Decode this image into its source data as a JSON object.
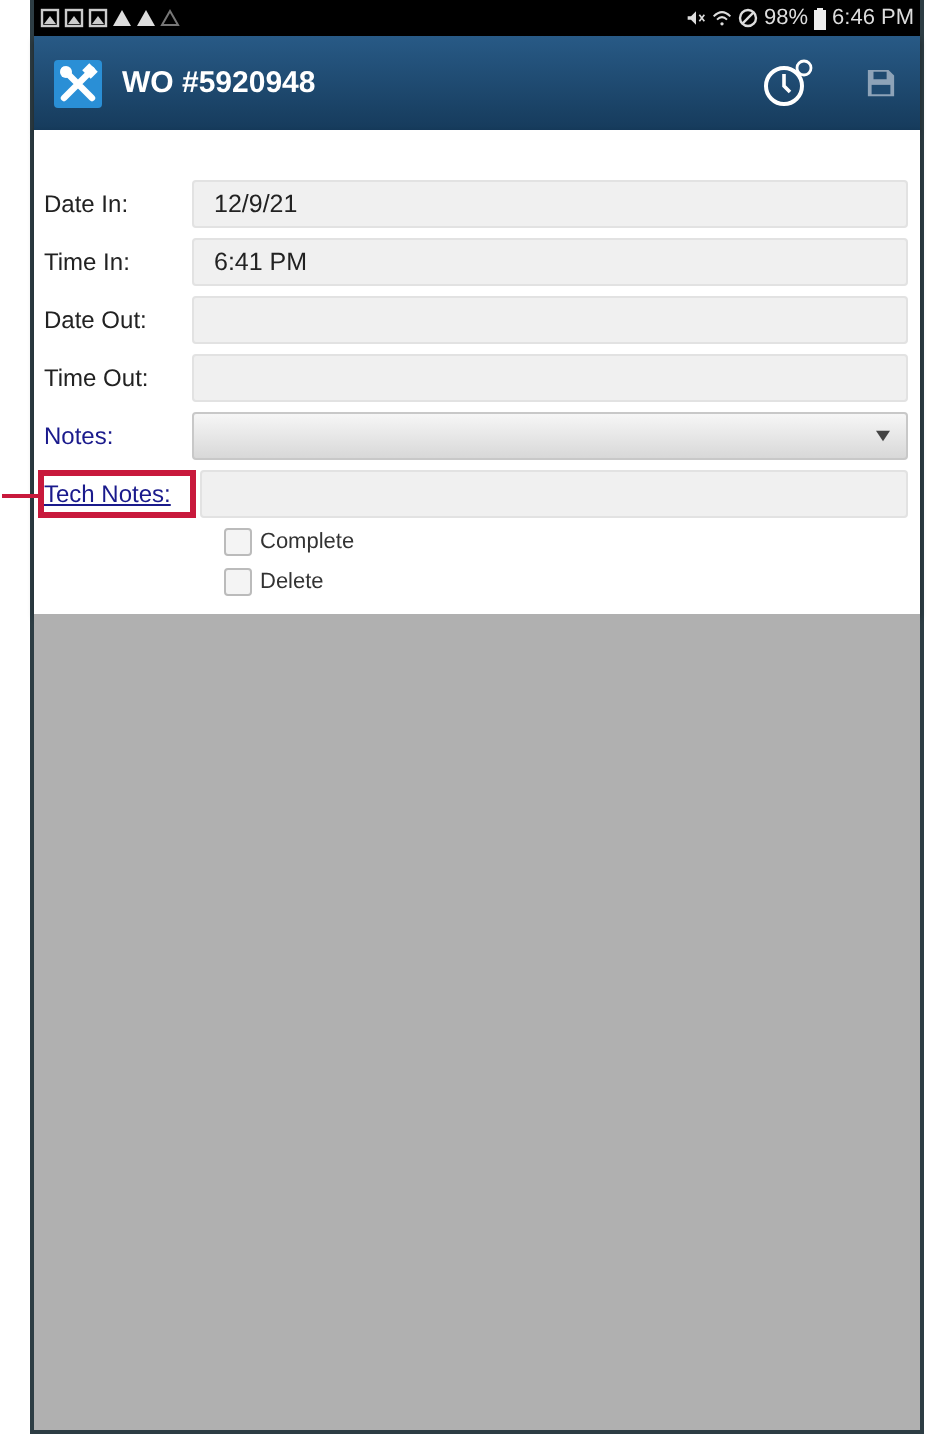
{
  "status_bar": {
    "battery": "98%",
    "time": "6:46 PM"
  },
  "app_bar": {
    "title": "WO #5920948"
  },
  "fields": [
    {
      "kind": "text",
      "label": "Date In:",
      "value": "12/9/21",
      "highlighted": false
    },
    {
      "kind": "text",
      "label": "Time In:",
      "value": "6:41 PM",
      "highlighted": false
    },
    {
      "kind": "text",
      "label": "Date Out:",
      "highlighted": false
    },
    {
      "kind": "text",
      "label": "Time Out:",
      "highlighted": false
    },
    {
      "kind": "select",
      "label": "Notes:",
      "highlighted": false
    },
    {
      "kind": "link",
      "label": "Tech Notes:",
      "highlighted": true
    }
  ],
  "checkboxes": [
    {
      "label": "Complete",
      "checked": false
    },
    {
      "label": "Delete",
      "checked": false
    }
  ]
}
